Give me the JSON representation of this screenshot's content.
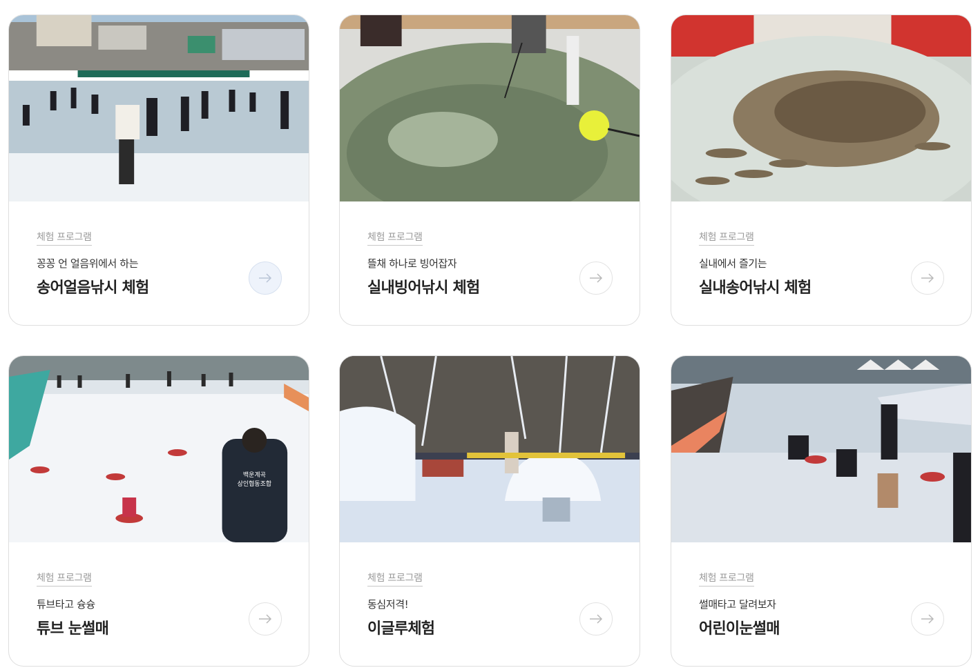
{
  "cards": [
    {
      "tag": "체험 프로그램",
      "subtitle": "꽁꽁 언 얼음위에서 하는",
      "title": "송어얼음낚시 체험",
      "image": "ice-fishing-photo",
      "active": true
    },
    {
      "tag": "체험 프로그램",
      "subtitle": "뜰채 하나로 빙어잡자",
      "title": "실내빙어낚시 체험",
      "image": "smelt-net-tank-photo",
      "active": false
    },
    {
      "tag": "체험 프로그램",
      "subtitle": "실내에서 즐기는",
      "title": "실내송어낚시 체험",
      "image": "trout-tank-photo",
      "active": false
    },
    {
      "tag": "체험 프로그램",
      "subtitle": "튜브타고 슝슝",
      "title": "튜브 눈썰매",
      "image": "tube-sled-photo",
      "active": false
    },
    {
      "tag": "체험 프로그램",
      "subtitle": "동심저격!",
      "title": "이글루체험",
      "image": "igloo-photo",
      "active": false
    },
    {
      "tag": "체험 프로그램",
      "subtitle": "썰매타고 달려보자",
      "title": "어린이눈썰매",
      "image": "kids-sled-photo",
      "active": false
    }
  ],
  "jacket_text": [
    "백운계곡",
    "상인협동조합"
  ],
  "arrow_icon": "arrow-right-icon",
  "colors": {
    "card_border": "#dedede",
    "tag_gray": "#9a9a9a",
    "active_button_bg": "#eef3fb",
    "arrow": "#b9b9b9"
  }
}
